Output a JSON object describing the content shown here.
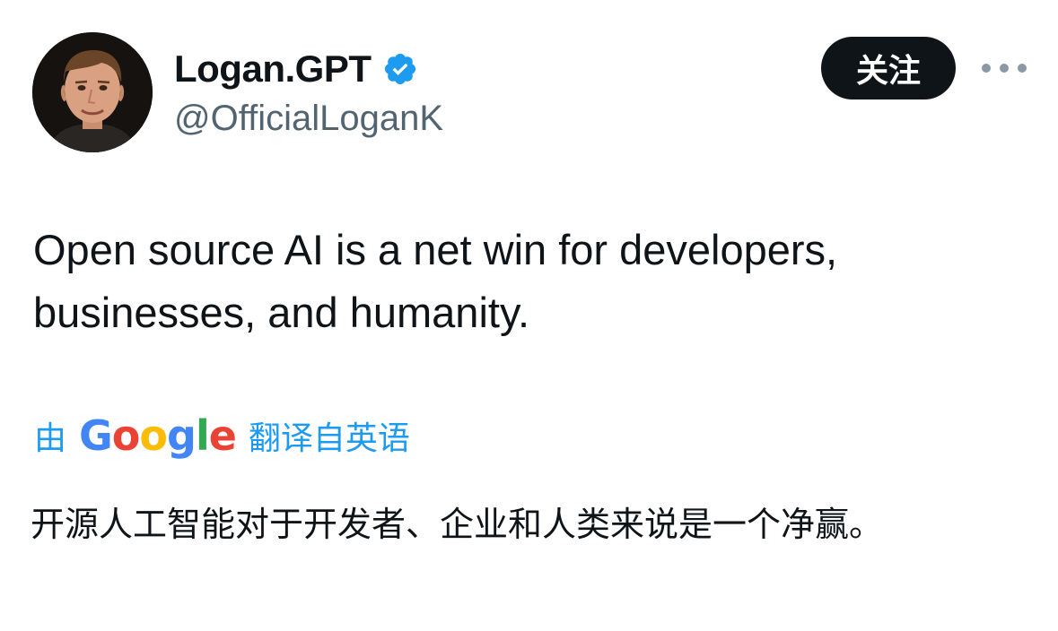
{
  "author": {
    "display_name": "Logan.GPT",
    "handle": "@OfficialLoganK",
    "verified": true,
    "avatar_icon": "user-avatar-photo",
    "verified_icon": "verified-badge-icon"
  },
  "actions": {
    "follow_label": "关注",
    "more_icon": "more-horizontal-icon"
  },
  "tweet": {
    "text": "Open source AI is a net win for developers, businesses, and humanity."
  },
  "translation": {
    "prefix": "由",
    "provider_letters": [
      "G",
      "o",
      "o",
      "g",
      "l",
      "e"
    ],
    "provider_colors": [
      "#4285F4",
      "#EA4335",
      "#FBBC05",
      "#4285F4",
      "#34A853",
      "#EA4335"
    ],
    "suffix": "翻译自英语",
    "text": "开源人工智能对于开发者、企业和人类来说是一个净赢。"
  },
  "colors": {
    "link_blue": "#1d9bf0",
    "secondary_text": "#536471",
    "primary_text": "#0f1419",
    "follow_button_bg": "#0f1419"
  }
}
